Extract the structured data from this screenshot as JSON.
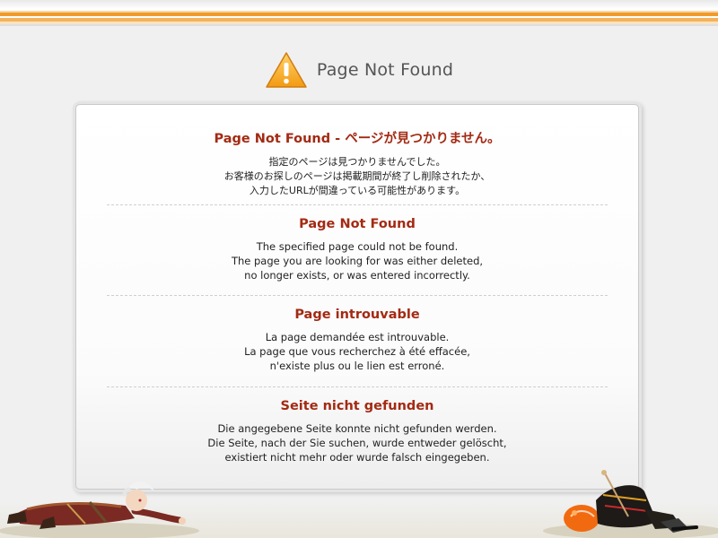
{
  "header": {
    "title": "Page Not Found",
    "icon": "warning-triangle-icon"
  },
  "sections": [
    {
      "heading": "Page Not Found - ページが見つかりません。",
      "lines": [
        "指定のページは見つかりませんでした。",
        "お客様のお探しのページは掲載期間が終了し削除されたか、",
        "入力したURLが間違っている可能性があります。"
      ]
    },
    {
      "heading": "Page Not Found",
      "lines": [
        "The specified page could not be found.",
        "The page you are looking for was either deleted,",
        "no longer exists, or was entered incorrectly."
      ]
    },
    {
      "heading": "Page introuvable",
      "lines": [
        "La page demandée est introuvable.",
        "La page que vous recherchez à été effacée,",
        "n'existe plus ou le lien est erroné."
      ]
    },
    {
      "heading": "Seite nicht gefunden",
      "lines": [
        "Die angegebene Seite konnte nicht gefunden werden.",
        "Die Seite, nach der Sie suchen, wurde entweder gelöscht,",
        "existiert nicht mehr oder wurde falsch eingegeben."
      ]
    }
  ],
  "colors": {
    "heading": "#a32a13",
    "accent_orange": "#f19a2a",
    "title_gray": "#555555"
  },
  "decorations": {
    "left": "fallen-character-left",
    "right": "fallen-character-right"
  }
}
